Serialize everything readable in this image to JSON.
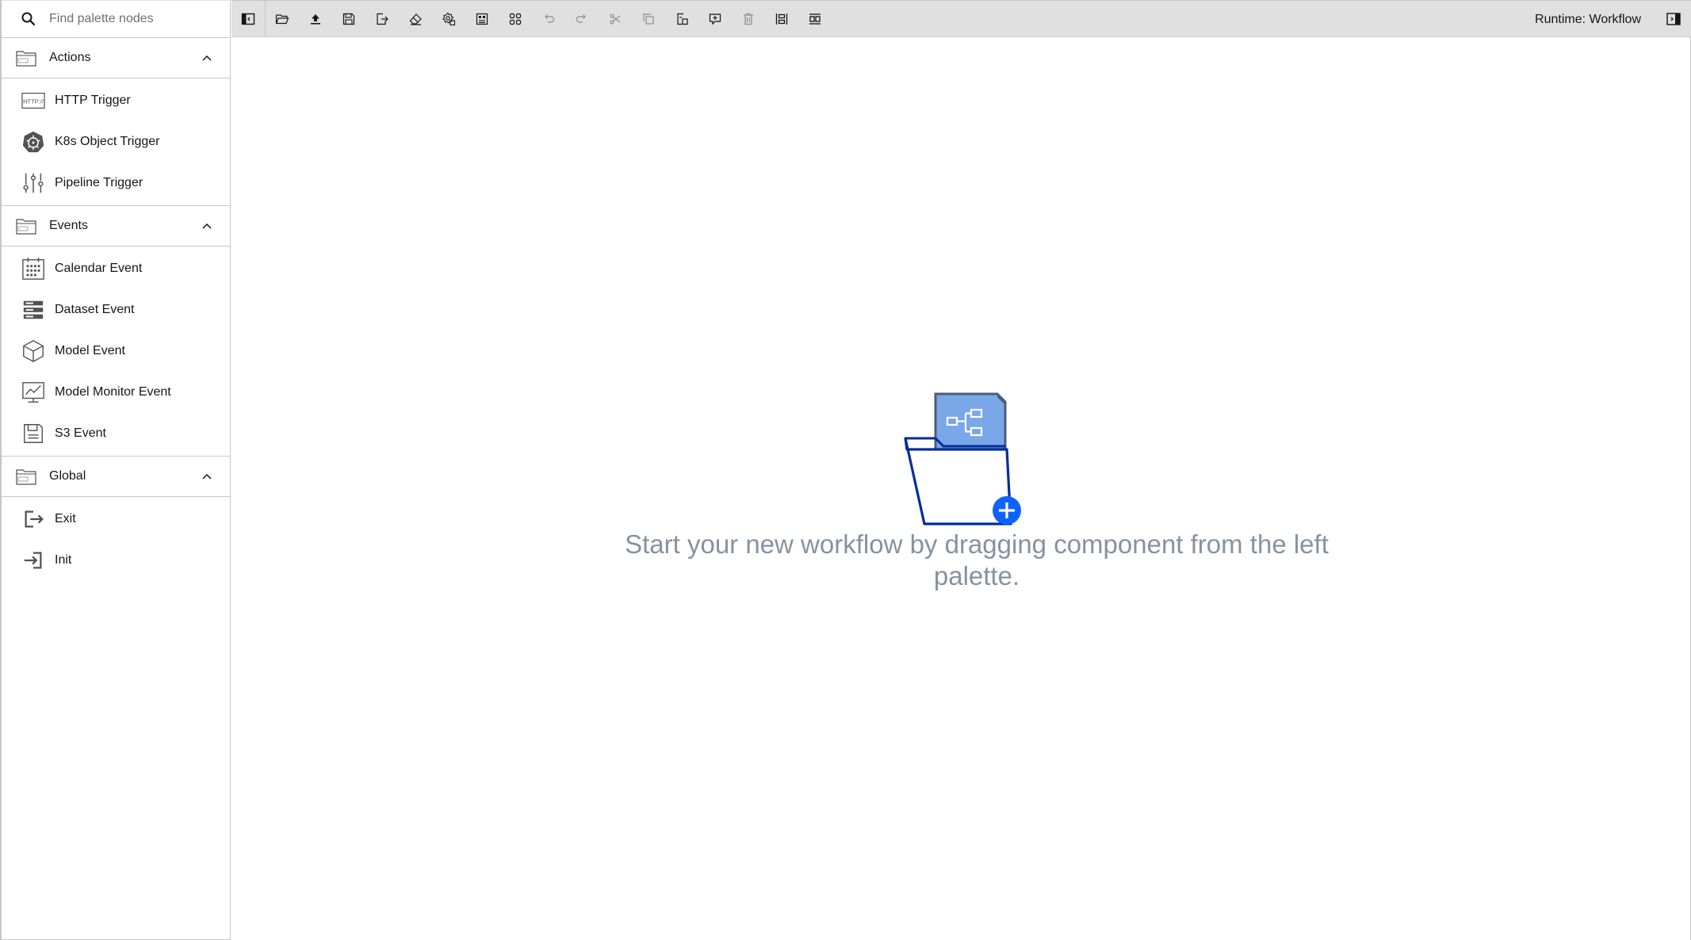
{
  "search": {
    "placeholder": "Find palette nodes"
  },
  "palette": {
    "categories": [
      {
        "label": "Actions",
        "items": [
          {
            "label": "HTTP Trigger",
            "icon": "http-icon"
          },
          {
            "label": "K8s Object Trigger",
            "icon": "kubernetes-icon"
          },
          {
            "label": "Pipeline Trigger",
            "icon": "sliders-icon"
          }
        ]
      },
      {
        "label": "Events",
        "items": [
          {
            "label": "Calendar Event",
            "icon": "calendar-icon"
          },
          {
            "label": "Dataset Event",
            "icon": "dataset-icon"
          },
          {
            "label": "Model Event",
            "icon": "cube-icon"
          },
          {
            "label": "Model Monitor Event",
            "icon": "monitor-chart-icon"
          },
          {
            "label": "S3 Event",
            "icon": "floppy-icon"
          }
        ]
      },
      {
        "label": "Global",
        "items": [
          {
            "label": "Exit",
            "icon": "exit-icon"
          },
          {
            "label": "Init",
            "icon": "init-icon"
          }
        ]
      }
    ]
  },
  "toolbar": {
    "runtime_label": "Runtime: Workflow"
  },
  "canvas": {
    "empty_message": "Start your new workflow by dragging component from the left palette."
  },
  "colors": {
    "accent": "#0f62fe",
    "toolbar_bg": "#e0e0e0",
    "empty_text": "#8593a0"
  }
}
